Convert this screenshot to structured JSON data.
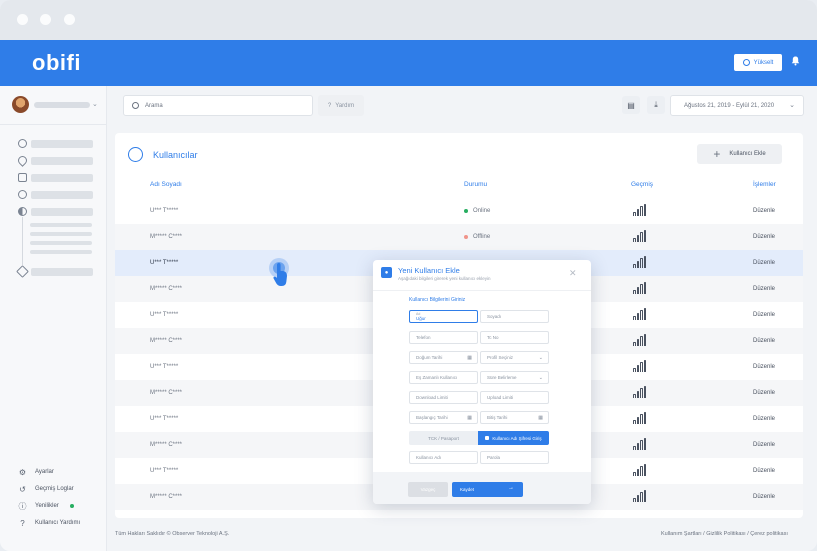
{
  "app": {
    "logo": "obifi",
    "upgrade_label": "Yükselt"
  },
  "toolbar": {
    "search_placeholder": "Arama",
    "help_label": "Yardım",
    "date_range": "Ağustos 21, 2019 - Eylül 21, 2020"
  },
  "sidebar": {
    "bottom_items": [
      {
        "label": "Ayarlar",
        "icon": "gear-icon"
      },
      {
        "label": "Geçmiş Loglar",
        "icon": "history-icon"
      },
      {
        "label": "Yenilikler",
        "icon": "info-icon"
      },
      {
        "label": "Kullanıcı Yardımı",
        "icon": "question-icon"
      }
    ]
  },
  "users": {
    "title": "Kullanıcılar",
    "add_label": "Kullanıcı Ekle",
    "columns": {
      "name": "Adı Soyadı",
      "status": "Durumu",
      "history": "Geçmiş",
      "actions": "İşlemler"
    },
    "rows": [
      {
        "name": "U*** T*****",
        "status": "Online",
        "action": "Düzenle"
      },
      {
        "name": "M***** C****",
        "status": "Offline",
        "action": "Düzenle"
      },
      {
        "name": "U*** T*****",
        "status": "",
        "action": "Düzenle"
      },
      {
        "name": "M***** C****",
        "status": "",
        "action": "Düzenle"
      },
      {
        "name": "U*** T*****",
        "status": "",
        "action": "Düzenle"
      },
      {
        "name": "M***** C****",
        "status": "",
        "action": "Düzenle"
      },
      {
        "name": "U*** T*****",
        "status": "",
        "action": "Düzenle"
      },
      {
        "name": "M***** C****",
        "status": "",
        "action": "Düzenle"
      },
      {
        "name": "U*** T*****",
        "status": "",
        "action": "Düzenle"
      },
      {
        "name": "M***** C****",
        "status": "",
        "action": "Düzenle"
      },
      {
        "name": "U*** T*****",
        "status": "",
        "action": "Düzenle"
      },
      {
        "name": "M***** C****",
        "status": "",
        "action": "Düzenle"
      }
    ]
  },
  "footer": {
    "copyright": "Tüm Hakları Saklıdır © Observer Teknoloji A.Ş.",
    "links": "Kullanım Şartları / Gizlilik Politikası / Çerez politikası"
  },
  "modal": {
    "title": "Yeni Kullanıcı Ekle",
    "subtitle": "Aşağıdaki bilgileri girerek yeni kullanıcı ekleyin",
    "section": "Kullanıcı Bilgilerini Giriniz",
    "fields": {
      "first_name_hint": "Ad",
      "first_name": "Uğur",
      "last_name": "Soyadı",
      "phone": "Telefon",
      "tc": "Tc No",
      "birth": "Doğum Tarihi",
      "profile": "Profil Seçiniz",
      "sim_user": "Eş Zamanlı Kullanıcı",
      "period": "Süre Belirleme",
      "download": "Download Limiti",
      "upload": "Upload Limiti",
      "start": "Başlangıç Tarihi",
      "end": "Bitiş Tarihi"
    },
    "seg_tc": "TCK / Pasaport",
    "seg_user": "Kullanıcı Adı Şifresi Giriş",
    "username": "Kullanıcı Adı",
    "password": "Parola",
    "cancel": "Vazgeç",
    "save": "Kaydet"
  },
  "colors": {
    "accent": "#2f7de8",
    "online": "#27ae60",
    "offline": "#f0948a"
  }
}
